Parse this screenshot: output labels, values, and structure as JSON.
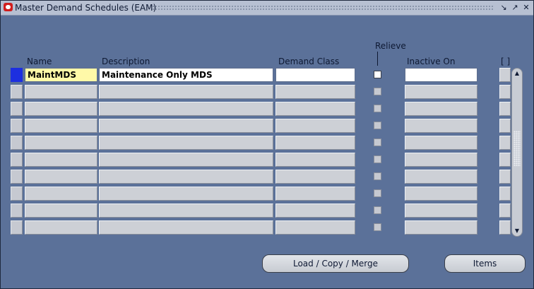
{
  "window": {
    "title": "Master Demand Schedules (EAM)"
  },
  "columns": {
    "name": "Name",
    "description": "Description",
    "demand_class": "Demand Class",
    "relieve": "Relieve",
    "inactive_on": "Inactive On",
    "extra": "[ ]"
  },
  "rows": [
    {
      "name": "MaintMDS",
      "description": "Maintenance Only MDS",
      "demand_class": "",
      "relieve": false,
      "inactive_on": ""
    },
    {
      "name": "",
      "description": "",
      "demand_class": "",
      "relieve": false,
      "inactive_on": ""
    },
    {
      "name": "",
      "description": "",
      "demand_class": "",
      "relieve": false,
      "inactive_on": ""
    },
    {
      "name": "",
      "description": "",
      "demand_class": "",
      "relieve": false,
      "inactive_on": ""
    },
    {
      "name": "",
      "description": "",
      "demand_class": "",
      "relieve": false,
      "inactive_on": ""
    },
    {
      "name": "",
      "description": "",
      "demand_class": "",
      "relieve": false,
      "inactive_on": ""
    },
    {
      "name": "",
      "description": "",
      "demand_class": "",
      "relieve": false,
      "inactive_on": ""
    },
    {
      "name": "",
      "description": "",
      "demand_class": "",
      "relieve": false,
      "inactive_on": ""
    },
    {
      "name": "",
      "description": "",
      "demand_class": "",
      "relieve": false,
      "inactive_on": ""
    },
    {
      "name": "",
      "description": "",
      "demand_class": "",
      "relieve": false,
      "inactive_on": ""
    }
  ],
  "buttons": {
    "load_copy_merge": "Load / Copy / Merge",
    "items": "Items"
  },
  "icons": {
    "app": "oracle-icon",
    "minimize": "minimize-icon",
    "maximize": "maximize-icon",
    "close": "close-icon",
    "scroll_up": "chevron-up-icon",
    "scroll_down": "chevron-down-icon"
  },
  "colors": {
    "background": "#5b7199",
    "field": "#cdd0d6",
    "active_field": "#ffffff",
    "current_field": "#fff9a8",
    "current_record": "#1d2fe0"
  }
}
